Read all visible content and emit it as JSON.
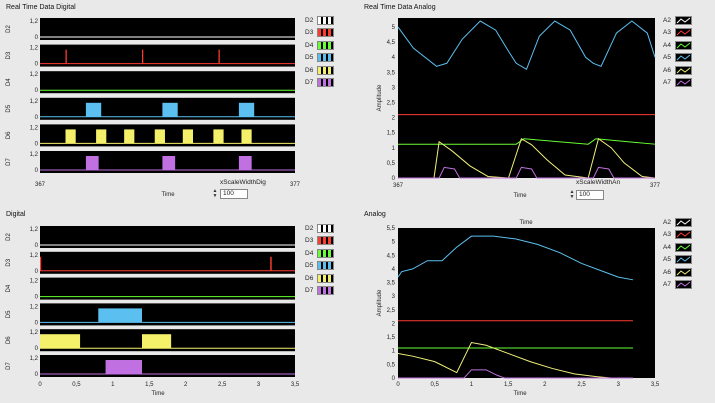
{
  "panels": {
    "rt_digital": {
      "title": "Real Time Data Digital",
      "channels": [
        "D2",
        "D3",
        "D4",
        "D5",
        "D6",
        "D7"
      ],
      "y_ticks": [
        "1,2",
        "0"
      ],
      "x_start": "367",
      "x_end": "377",
      "x_label": "Time",
      "scale_label": "xScaleWidthDig",
      "scale_value": "100"
    },
    "rt_analog": {
      "title": "Real Time Data Analog",
      "y_label": "Amplitude",
      "y_ticks": [
        "5",
        "4,5",
        "4",
        "3,5",
        "3",
        "2,5",
        "2",
        "1,5",
        "1",
        "0,5",
        "0"
      ],
      "x_start": "367",
      "x_end": "377",
      "x_label": "Time",
      "scale_label": "xScaleWidthAn",
      "scale_value": "100"
    },
    "digital": {
      "title": "Digital",
      "channels": [
        "D2",
        "D3",
        "D4",
        "D5",
        "D6",
        "D7"
      ],
      "y_ticks": [
        "1,2",
        "0"
      ],
      "x_ticks": [
        "0",
        "0,5",
        "1",
        "1,5",
        "2",
        "2,5",
        "3",
        "3,5"
      ],
      "x_label": "Time"
    },
    "analog": {
      "title": "Analog",
      "y_label": "Amplitude",
      "y_ticks": [
        "5,5",
        "5",
        "4,5",
        "4",
        "3,5",
        "3",
        "2,5",
        "2",
        "1,5",
        "1",
        "0,5",
        "0"
      ],
      "x_ticks": [
        "0",
        "0,5",
        "1",
        "1,5",
        "2",
        "2,5",
        "3",
        "3,5"
      ],
      "x_label": "Time"
    }
  },
  "legend_digital": [
    {
      "label": "D2",
      "color": "#ffffff"
    },
    {
      "label": "D3",
      "color": "#ff3b30"
    },
    {
      "label": "D4",
      "color": "#66ff33"
    },
    {
      "label": "D5",
      "color": "#5bc0f0"
    },
    {
      "label": "D6",
      "color": "#f5f06a"
    },
    {
      "label": "D7",
      "color": "#c070e0"
    }
  ],
  "legend_analog": [
    {
      "label": "A2",
      "color": "#ffffff"
    },
    {
      "label": "A3",
      "color": "#ff3b30"
    },
    {
      "label": "A4",
      "color": "#66ff33"
    },
    {
      "label": "A5",
      "color": "#5bc0f0"
    },
    {
      "label": "A6",
      "color": "#f0f07a"
    },
    {
      "label": "A7",
      "color": "#c070e0"
    }
  ],
  "chart_data": [
    {
      "type": "line",
      "title": "Real Time Data Digital",
      "xlabel": "Time",
      "xlim": [
        367,
        377
      ],
      "ylim": [
        0,
        1.2
      ],
      "series": [
        {
          "name": "D2",
          "intervals": []
        },
        {
          "name": "D3",
          "intervals": [
            [
              368.0,
              368.05
            ],
            [
              371.0,
              371.05
            ],
            [
              374.0,
              374.05
            ]
          ]
        },
        {
          "name": "D4",
          "intervals": []
        },
        {
          "name": "D5",
          "intervals": [
            [
              368.8,
              369.4
            ],
            [
              371.8,
              372.4
            ],
            [
              374.8,
              375.4
            ]
          ]
        },
        {
          "name": "D6",
          "intervals": [
            [
              368.0,
              368.4
            ],
            [
              369.2,
              369.6
            ],
            [
              370.3,
              370.7
            ],
            [
              371.5,
              371.9
            ],
            [
              372.6,
              373.0
            ],
            [
              373.8,
              374.2
            ],
            [
              374.9,
              375.3
            ]
          ]
        },
        {
          "name": "D7",
          "intervals": [
            [
              368.8,
              369.3
            ],
            [
              371.8,
              372.3
            ],
            [
              374.8,
              375.3
            ]
          ]
        }
      ]
    },
    {
      "type": "line",
      "title": "Real Time Data Analog",
      "xlabel": "Time",
      "ylabel": "Amplitude",
      "xlim": [
        367,
        377
      ],
      "ylim": [
        0,
        5.3
      ],
      "series": [
        {
          "name": "A3",
          "x": [
            367,
            377
          ],
          "y": [
            2.1,
            2.1
          ]
        },
        {
          "name": "A4",
          "x": [
            367,
            371.6,
            371.9,
            374.4,
            374.7,
            377
          ],
          "y": [
            1.12,
            1.12,
            1.3,
            1.12,
            1.3,
            1.12
          ]
        },
        {
          "name": "A5",
          "x": [
            367,
            367.6,
            368.5,
            368.9,
            369.5,
            370.2,
            370.8,
            371.3,
            371.6,
            372.0,
            372.5,
            373.1,
            373.7,
            374.3,
            374.6,
            374.9,
            375.5,
            376.1,
            376.7,
            377
          ],
          "y": [
            5.0,
            4.3,
            3.7,
            3.8,
            4.6,
            5.2,
            4.9,
            4.2,
            3.8,
            3.6,
            4.7,
            5.2,
            4.9,
            4.0,
            3.8,
            3.7,
            4.8,
            5.2,
            4.8,
            4.0
          ]
        },
        {
          "name": "A6",
          "x": [
            367,
            368.4,
            368.6,
            369.1,
            369.8,
            370.5,
            371.3,
            371.8,
            372.2,
            372.8,
            373.5,
            374.4,
            374.8,
            375.3,
            375.8,
            376.5,
            377
          ],
          "y": [
            0,
            0,
            1.2,
            0.9,
            0.4,
            0.05,
            0,
            1.3,
            1.1,
            0.6,
            0.1,
            0,
            1.3,
            1.0,
            0.5,
            0.05,
            0
          ]
        },
        {
          "name": "A7",
          "x": [
            367,
            368.6,
            368.8,
            369.2,
            369.4,
            371.6,
            371.8,
            372.2,
            372.4,
            374.6,
            374.8,
            375.2,
            375.4,
            377
          ],
          "y": [
            0,
            0,
            0.35,
            0.3,
            0,
            0,
            0.35,
            0.3,
            0,
            0,
            0.35,
            0.3,
            0,
            0
          ]
        }
      ]
    },
    {
      "type": "line",
      "title": "Digital",
      "xlabel": "Time",
      "xlim": [
        0,
        3.5
      ],
      "ylim": [
        0,
        1.2
      ],
      "series": [
        {
          "name": "D2",
          "intervals": []
        },
        {
          "name": "D3",
          "intervals": [
            [
              0.0,
              0.01
            ],
            [
              3.16,
              3.18
            ]
          ]
        },
        {
          "name": "D4",
          "intervals": []
        },
        {
          "name": "D5",
          "intervals": [
            [
              0.8,
              1.4
            ]
          ]
        },
        {
          "name": "D6",
          "intervals": [
            [
              0.0,
              0.55
            ],
            [
              1.4,
              1.8
            ]
          ]
        },
        {
          "name": "D7",
          "intervals": [
            [
              0.9,
              1.4
            ]
          ]
        }
      ]
    },
    {
      "type": "line",
      "title": "Analog",
      "xlabel": "Time",
      "ylabel": "Amplitude",
      "xlim": [
        0,
        3.5
      ],
      "ylim": [
        0,
        5.5
      ],
      "series": [
        {
          "name": "A3",
          "x": [
            0,
            3.2
          ],
          "y": [
            2.1,
            2.1
          ]
        },
        {
          "name": "A4",
          "x": [
            0,
            3.2
          ],
          "y": [
            1.1,
            1.1
          ]
        },
        {
          "name": "A5",
          "x": [
            0,
            0.05,
            0.2,
            0.4,
            0.6,
            0.8,
            1.0,
            1.3,
            1.6,
            1.9,
            2.2,
            2.5,
            2.8,
            3.0,
            3.2
          ],
          "y": [
            3.7,
            3.9,
            4.0,
            4.3,
            4.3,
            4.8,
            5.2,
            5.2,
            5.1,
            4.9,
            4.6,
            4.2,
            3.9,
            3.7,
            3.6
          ]
        },
        {
          "name": "A6",
          "x": [
            0,
            0.2,
            0.5,
            0.8,
            1.0,
            1.2,
            1.5,
            1.8,
            2.1,
            2.4,
            2.7,
            2.9
          ],
          "y": [
            0.9,
            0.8,
            0.6,
            0.2,
            1.3,
            1.2,
            0.9,
            0.6,
            0.35,
            0.15,
            0.05,
            0
          ]
        },
        {
          "name": "A7",
          "x": [
            0,
            0.9,
            1.0,
            1.2,
            1.35,
            1.45,
            3.2
          ],
          "y": [
            0,
            0,
            0.3,
            0.3,
            0.1,
            0,
            0
          ]
        }
      ]
    }
  ]
}
